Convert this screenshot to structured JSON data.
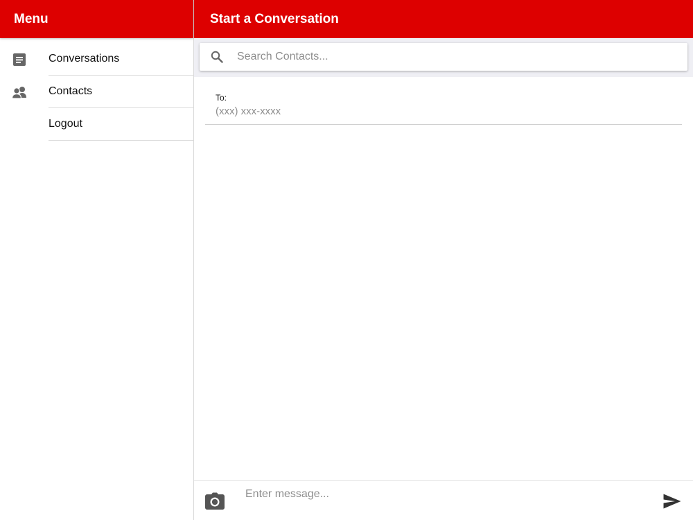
{
  "sidebar": {
    "title": "Menu",
    "items": [
      {
        "label": "Conversations",
        "icon": "document-icon"
      },
      {
        "label": "Contacts",
        "icon": "contacts-icon"
      },
      {
        "label": "Logout",
        "icon": ""
      }
    ]
  },
  "main": {
    "title": "Start a Conversation",
    "search": {
      "placeholder": "Search Contacts..."
    },
    "to": {
      "label": "To:",
      "placeholder": "(xxx) xxx-xxxx"
    },
    "composer": {
      "placeholder": "Enter message..."
    }
  },
  "colors": {
    "header": "#dd0000",
    "icon": "#666666"
  }
}
